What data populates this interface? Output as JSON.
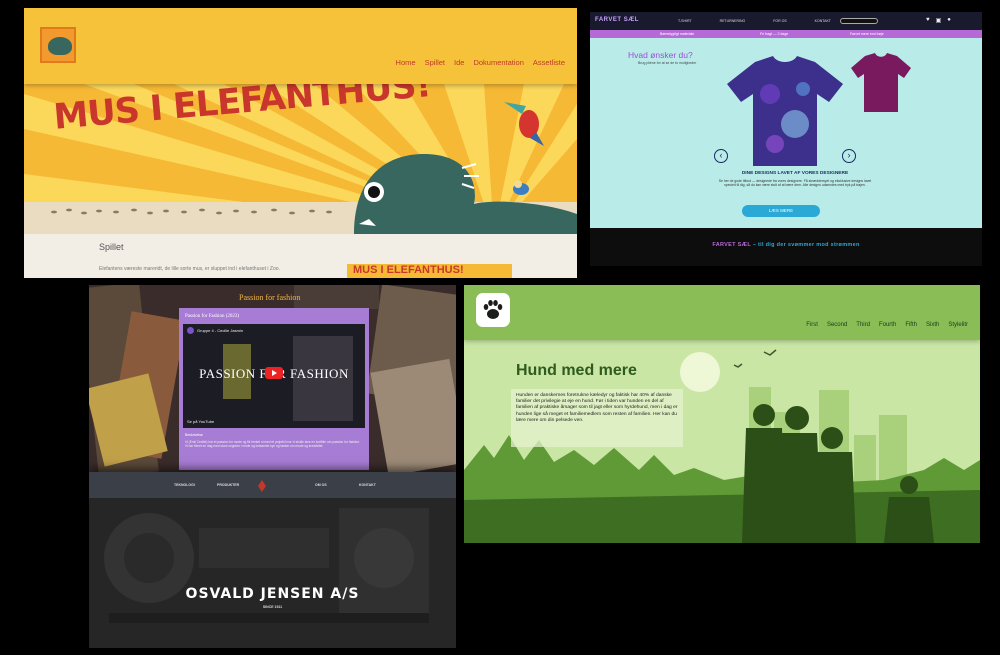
{
  "panel1": {
    "nav": [
      "Home",
      "Spillet",
      "Ide",
      "Dokumentation",
      "Assetliste"
    ],
    "hero_title": "MUS I ELEFANTHUS!",
    "section_title": "Spillet",
    "body_text": "Elefantens væreste mareridt, de lille sorte mus, er sluppet ind i elefanthuset i Zoo.",
    "mini_logo": "MUS I ELEFANTHUS!",
    "colors": {
      "bg": "#f6c23a",
      "title": "#c9372c"
    }
  },
  "panel2": {
    "brand": "FARVET SÆL",
    "nav": [
      "T-SHIRT",
      "RETURNERING",
      "FOR OS",
      "KONTAKT",
      "KONTAKT OS"
    ],
    "strip": [
      "Bæredygtigt materiale",
      "Fri fragt — 2 dage",
      "Farvet mere end trøje"
    ],
    "question": "Hvad ønsker du?",
    "question_sub": "Brug pilene for at se de to muligheder",
    "headline": "DINE DESIGNS LAVET AF VORES DESIGNERE",
    "description": "Se her de gode tilbud — designede fra vores designere. Få skræddersyet og eksklusive designs lavet specielt til dig, så du kan være stolt af at bære dem. Alle designs udsendes med tryk på trøjen.",
    "button": "LÆS MERE",
    "footer_brand": "FARVET SÆL",
    "footer_tag": " – til dig der svømmer mod strømmen"
  },
  "panel3": {
    "page_title": "Passion for fashion",
    "card_title": "Passion for Fashion (2023)",
    "channel": "Gruppe 4 - Cecilie Jasmin",
    "video_text": "PASSION FOR FASHION",
    "watch": "Se på YouTube",
    "label": "Beskrivelse",
    "desc": "Vi (Emil Cecilie) har et passion for mode og fik hentet ni med et projekt hvor vi skulle lave en kortfilm om passion for fashion. Vi har filmet en dag med store ungdom i mode og indsamlet syn og tanker om mode og kreativitet.",
    "nav": [
      "TEKNOLOGI",
      "PRODUKTER",
      "OM OS",
      "KONTAKT"
    ],
    "company": "OSVALD JENSEN A/S",
    "since": "SINCE 1911"
  },
  "panel4": {
    "nav": [
      "First",
      "Second",
      "Third",
      "Fourth",
      "Fifth",
      "Sixth",
      "Stylelitr"
    ],
    "title": "Hund med mere",
    "text": "Hunden er danskernes foretrukne kæledyr og faktisk har 40% af danske familier det privilegie at eje en hund. Før i tiden var hunden en del af familien af praktiske årsager som til jagt eller som hyrdehund, men i dag er hunden lige så meget et familiemedlem som resten af familien. Her kan du lære mere om din pelsede ven.",
    "colors": {
      "header": "#8bbd56",
      "title": "#2f5b1e"
    }
  }
}
